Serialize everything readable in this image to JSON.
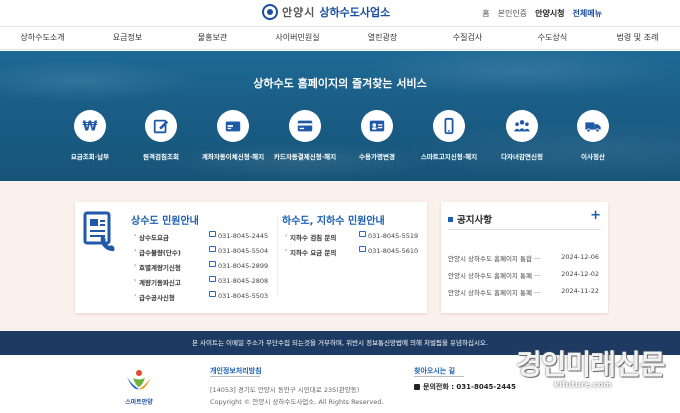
{
  "header": {
    "logo_city": "안양시",
    "logo_dept": "상하수도사업소",
    "utility": {
      "home": "홈",
      "auth": "본인인증",
      "city_hall": "안양시청",
      "all_menu": "전체메뉴"
    }
  },
  "nav": {
    "items": [
      "상하수도소개",
      "요금정보",
      "물홍보관",
      "사이버민원실",
      "열린광장",
      "수질검사",
      "수도상식",
      "법령 및 조례"
    ]
  },
  "hero": {
    "title": "상하수도 홈페이지의 즐겨찾는 서비스",
    "services": [
      {
        "label": "요금조회·납부",
        "icon": "won-icon"
      },
      {
        "label": "원격검침조회",
        "icon": "edit-icon"
      },
      {
        "label": "계좌자동이체신청·해지",
        "icon": "bank-card-icon"
      },
      {
        "label": "카드자동결제신청·해지",
        "icon": "credit-card-icon"
      },
      {
        "label": "수용가명변경",
        "icon": "id-card-icon"
      },
      {
        "label": "스마트고지신청·해지",
        "icon": "smartphone-icon"
      },
      {
        "label": "다자녀감면신청",
        "icon": "family-icon"
      },
      {
        "label": "이사정산",
        "icon": "truck-icon"
      }
    ]
  },
  "civil": {
    "water_title": "상수도 민원안내",
    "water_rows": [
      {
        "name": "상수도요금",
        "tel": "031-8045-2445"
      },
      {
        "name": "급수불량(단수)",
        "tel": "031-8045-5504"
      },
      {
        "name": "호별계량기신청",
        "tel": "031-8045-2899"
      },
      {
        "name": "계량기동파신고",
        "tel": "031-8045-2808"
      },
      {
        "name": "급수공사신청",
        "tel": "031-8045-5503"
      }
    ],
    "sewer_title": "하수도, 지하수 민원안내",
    "sewer_rows": [
      {
        "name": "지하수 검침 문의",
        "tel": "031-8045-5519"
      },
      {
        "name": "지하수 요금 문의",
        "tel": "031-8045-5610"
      }
    ]
  },
  "notice": {
    "title": "공지사항",
    "plus": "+",
    "items": [
      {
        "title": "안양시 상하수도 홈페이지 통합 ···",
        "date": "2024-12-06"
      },
      {
        "title": "안양시 상하수도 홈페이지 통폐 ···",
        "date": "2024-12-02"
      },
      {
        "title": "안양시 상하수도 홈페이지 통폐 ···",
        "date": "2024-11-22"
      }
    ]
  },
  "strip": {
    "text": "본 사이트는 이메일 주소가 무단수집 되는것을 거부하며, 위반시 정보통신망법에 의해 처벌됨을 유념하십시오."
  },
  "footer": {
    "logo_text": "스마트안양",
    "privacy": "개인정보처리방침",
    "address": "[14053] 경기도 안양시 동안구 시민대로 235(관양동)",
    "copyright": "Copyright © 안양시 상하수도사업소. All Rights Reserved.",
    "directions": "찾아오시는 길",
    "tel": "문의전화 : 031-8045-2445"
  },
  "watermark": {
    "main": "경인미래신문",
    "url": "kifuture.com"
  },
  "colors": {
    "brand": "#1a4fa0",
    "accent": "#1a5fb0",
    "hero": "#1a5d86",
    "strip": "#1d3a63",
    "band": "#fbf1ec"
  }
}
